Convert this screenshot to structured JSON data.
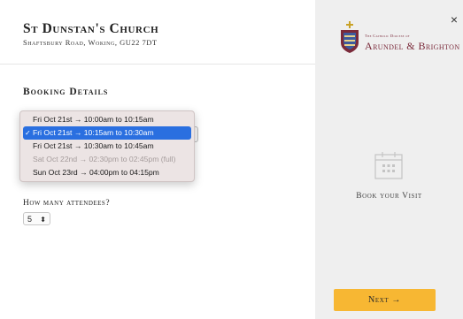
{
  "header": {
    "church_name": "St Dunstan's Church",
    "address": "Shaftsbury Road, Woking, GU22 7DT"
  },
  "booking": {
    "section_title": "Booking Details",
    "slot_options": [
      {
        "label": "Fri Oct 21st → 10:00am to 10:15am",
        "selected": false,
        "disabled": false
      },
      {
        "label": "Fri Oct 21st → 10:15am to 10:30am",
        "selected": true,
        "disabled": false
      },
      {
        "label": "Fri Oct 21st → 10:30am to 10:45am",
        "selected": false,
        "disabled": false
      },
      {
        "label": "Sat Oct 22nd → 02:30pm to 02:45pm (full)",
        "selected": false,
        "disabled": true
      },
      {
        "label": "Sun Oct 23rd → 04:00pm to 04:15pm",
        "selected": false,
        "disabled": false
      }
    ],
    "check_mark": "✓",
    "attendees_label": "How many attendees?",
    "attendees_value": "5",
    "stepper_arrows": "⬍"
  },
  "sidebar": {
    "close_label": "×",
    "diocese_small": "The Catholic Diocese of",
    "diocese_name": "Arundel & Brighton",
    "book_visit_label": "Book your Visit",
    "next_label": "Next →",
    "calendar_icon": "calendar-icon",
    "accent_color": "#f7b733"
  }
}
